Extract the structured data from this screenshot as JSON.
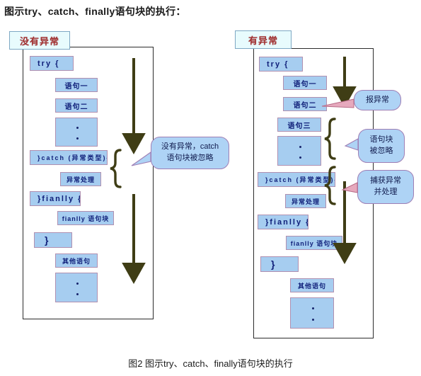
{
  "title": "图示try、catch、finally语句块的执行：",
  "caption": "图2  图示try、catch、finally语句块的执行",
  "colors": {
    "block_fill": "#a6cdf0",
    "block_border": "#b090b0",
    "block_text": "#10207a",
    "callout_fill": "#aed3f5",
    "callout_border": "#9f7fb5",
    "tag_fill": "#e8fbfd",
    "tag_border": "#7ea8c4",
    "tag_text": "#a03030",
    "arrow": "#3f3d15",
    "frame": "#2c2c2c"
  },
  "left_panel": {
    "tag": "没有异常",
    "blocks": [
      {
        "name": "try-open",
        "text": "try  {"
      },
      {
        "name": "statement-1",
        "text": "语句一"
      },
      {
        "name": "statement-2",
        "text": "语句二"
      },
      {
        "name": "statement-dots",
        "text": "."
      },
      {
        "name": "catch-open",
        "text": "}catch (异常类型){"
      },
      {
        "name": "exception-handling",
        "text": "异常处理"
      },
      {
        "name": "finally-open",
        "text": "}fianlly {"
      },
      {
        "name": "finally-body",
        "text": "fianlly 语句块"
      },
      {
        "name": "close-brace",
        "text": "}"
      },
      {
        "name": "other-statements",
        "text": "其他语句"
      },
      {
        "name": "trailing-dots",
        "text": "."
      }
    ],
    "callout": {
      "name": "no-exception-callout",
      "line1": "没有异常，catch",
      "line2": "语句块被忽略"
    }
  },
  "right_panel": {
    "tag": "有异常",
    "blocks": [
      {
        "name": "try-open",
        "text": "try  {"
      },
      {
        "name": "statement-1",
        "text": "语句一"
      },
      {
        "name": "statement-2",
        "text": "语句二"
      },
      {
        "name": "statement-3",
        "text": "语句三"
      },
      {
        "name": "statement-dots",
        "text": "."
      },
      {
        "name": "catch-open",
        "text": "}catch (异常类型){"
      },
      {
        "name": "exception-handling",
        "text": "异常处理"
      },
      {
        "name": "finally-open",
        "text": "}fianlly {"
      },
      {
        "name": "finally-body",
        "text": "fianlly 语句块"
      },
      {
        "name": "close-brace",
        "text": "}"
      },
      {
        "name": "other-statements",
        "text": "其他语句"
      },
      {
        "name": "trailing-dots",
        "text": "."
      }
    ],
    "callouts": [
      {
        "name": "throw-exception-callout",
        "line1": "报异常",
        "line2": ""
      },
      {
        "name": "block-ignored-callout",
        "line1": "语句块",
        "line2": "被忽略"
      },
      {
        "name": "catch-handle-callout",
        "line1": "捕获异常",
        "line2": "并处理"
      }
    ]
  }
}
